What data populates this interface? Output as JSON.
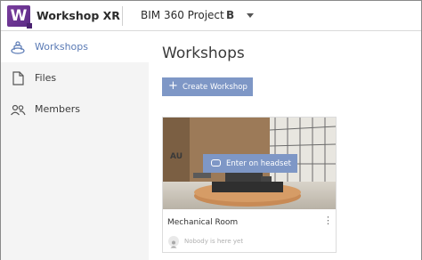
{
  "header": {
    "logo_letter": "W",
    "app_title": "Workshop XR",
    "project_name": "BIM 360 Project",
    "project_badge": "B"
  },
  "sidebar": {
    "items": [
      {
        "label": "Workshops",
        "icon": "workshops-icon",
        "active": true
      },
      {
        "label": "Files",
        "icon": "file-icon",
        "active": false
      },
      {
        "label": "Members",
        "icon": "members-icon",
        "active": false
      }
    ]
  },
  "main": {
    "title": "Workshops",
    "create_button_label": "Create Workshop",
    "cards": [
      {
        "title": "Mechanical Room",
        "enter_button_label": "Enter on headset",
        "presence_text": "Nobody is here yet"
      }
    ]
  },
  "colors": {
    "accent": "#7e97c6",
    "brand": "#6a3591",
    "active_nav_text": "#5a7ab5",
    "sidebar_bg": "#f4f4f4"
  }
}
